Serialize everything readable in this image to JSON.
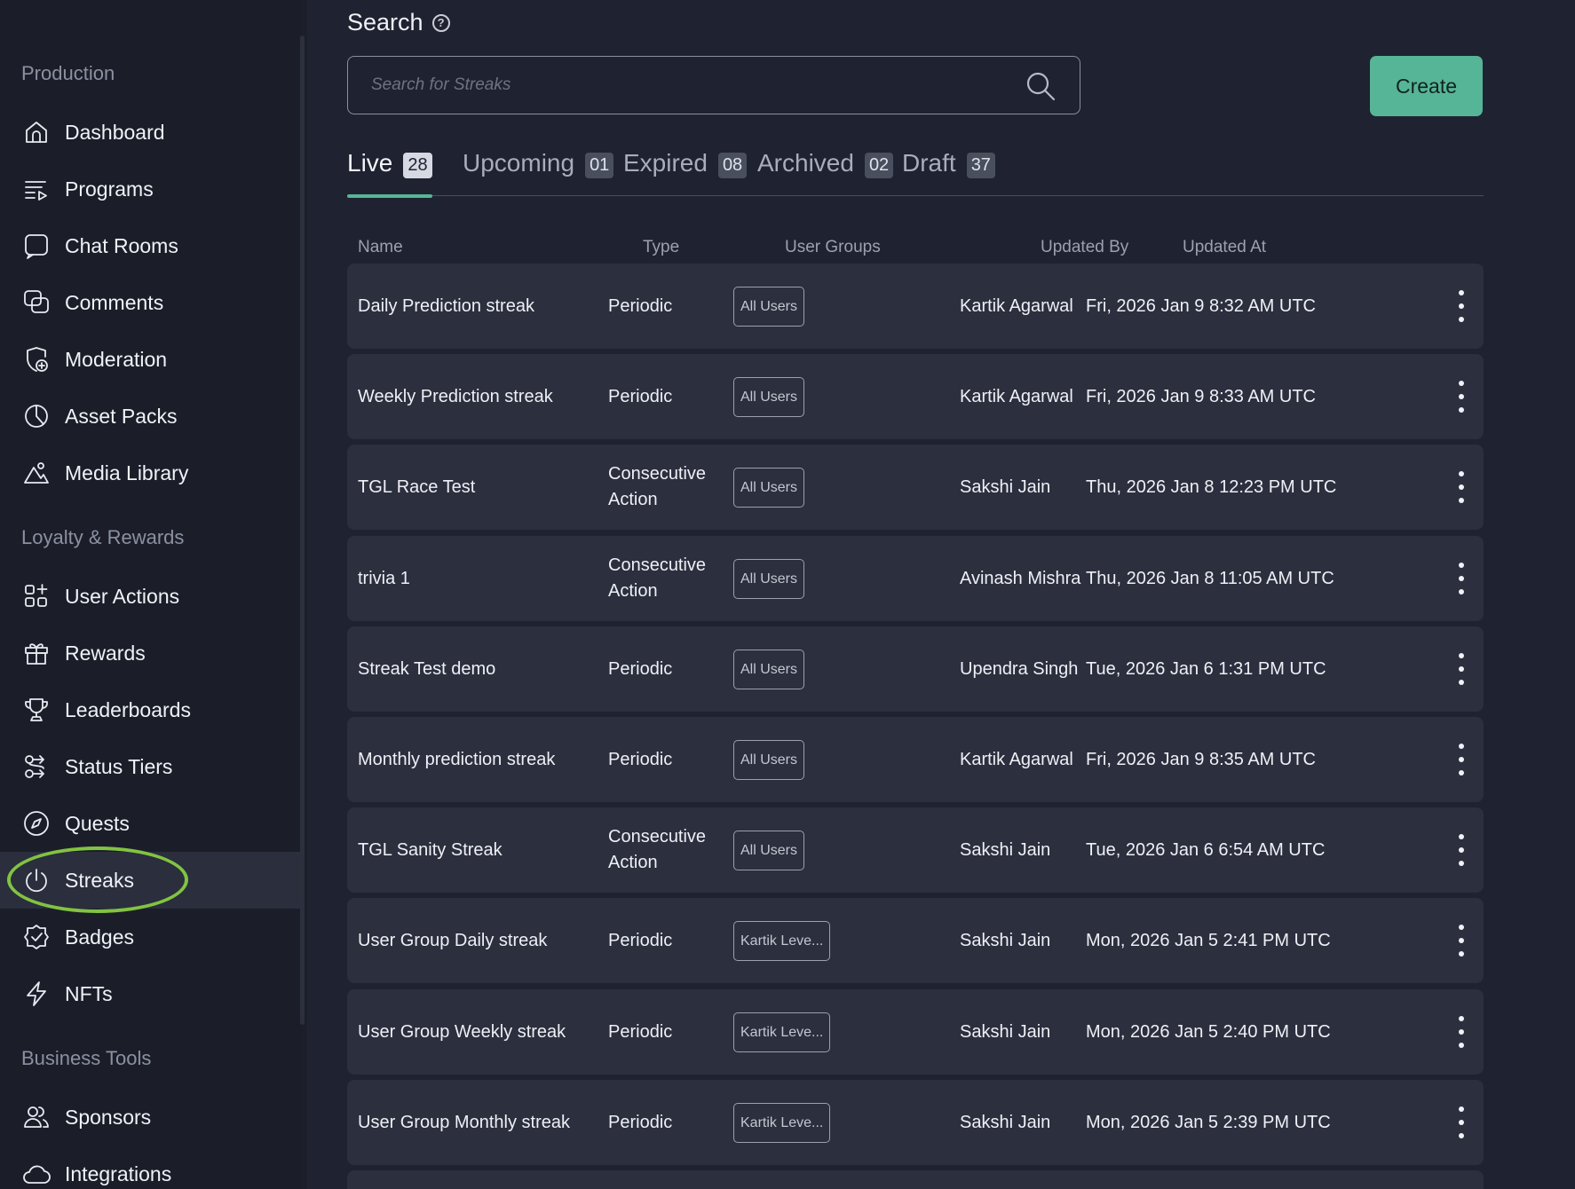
{
  "sidebar": {
    "sections": [
      {
        "title": "Production"
      },
      {
        "title": "Loyalty & Rewards"
      },
      {
        "title": "Business Tools"
      }
    ],
    "items": [
      {
        "label": "Dashboard",
        "icon": "home-icon"
      },
      {
        "label": "Programs",
        "icon": "programs-icon"
      },
      {
        "label": "Chat Rooms",
        "icon": "chat-icon"
      },
      {
        "label": "Comments",
        "icon": "comments-icon"
      },
      {
        "label": "Moderation",
        "icon": "moderation-icon"
      },
      {
        "label": "Asset Packs",
        "icon": "asset-packs-icon"
      },
      {
        "label": "Media Library",
        "icon": "media-library-icon"
      },
      {
        "label": "User Actions",
        "icon": "user-actions-icon"
      },
      {
        "label": "Rewards",
        "icon": "gift-icon"
      },
      {
        "label": "Leaderboards",
        "icon": "trophy-icon"
      },
      {
        "label": "Status Tiers",
        "icon": "status-tiers-icon"
      },
      {
        "label": "Quests",
        "icon": "compass-icon"
      },
      {
        "label": "Streaks",
        "icon": "streak-icon"
      },
      {
        "label": "Badges",
        "icon": "badge-icon"
      },
      {
        "label": "NFTs",
        "icon": "lightning-icon"
      },
      {
        "label": "Sponsors",
        "icon": "users-icon"
      },
      {
        "label": "Integrations",
        "icon": "cloud-icon"
      }
    ],
    "active_item": "Streaks"
  },
  "main": {
    "search_title": "Search",
    "search_placeholder": "Search for Streaks",
    "create_label": "Create",
    "tabs": [
      {
        "label": "Live",
        "count": "28"
      },
      {
        "label": "Upcoming",
        "count": "01"
      },
      {
        "label": "Expired",
        "count": "08"
      },
      {
        "label": "Archived",
        "count": "02"
      },
      {
        "label": "Draft",
        "count": "37"
      }
    ],
    "active_tab": "Live",
    "columns": [
      "Name",
      "Type",
      "User Groups",
      "Updated By",
      "Updated At"
    ],
    "rows": [
      {
        "name": "Daily Prediction streak",
        "type": "Periodic",
        "group": "All Users",
        "by": "Kartik Agarwal",
        "at": "Fri, 2026 Jan 9 8:32 AM UTC"
      },
      {
        "name": "Weekly Prediction streak",
        "type": "Periodic",
        "group": "All Users",
        "by": "Kartik Agarwal",
        "at": "Fri, 2026 Jan 9 8:33 AM UTC"
      },
      {
        "name": "TGL Race Test",
        "type": "Consecutive Action",
        "group": "All Users",
        "by": "Sakshi Jain",
        "at": "Thu, 2026 Jan 8 12:23 PM UTC"
      },
      {
        "name": "trivia 1",
        "type": "Consecutive Action",
        "group": "All Users",
        "by": "Avinash Mishra",
        "at": "Thu, 2026 Jan 8 11:05 AM UTC"
      },
      {
        "name": "Streak Test demo",
        "type": "Periodic",
        "group": "All Users",
        "by": "Upendra Singh",
        "at": "Tue, 2026 Jan 6 1:31 PM UTC"
      },
      {
        "name": "Monthly prediction streak",
        "type": "Periodic",
        "group": "All Users",
        "by": "Kartik Agarwal",
        "at": "Fri, 2026 Jan 9 8:35 AM UTC"
      },
      {
        "name": "TGL Sanity Streak",
        "type": "Consecutive Action",
        "group": "All Users",
        "by": "Sakshi Jain",
        "at": "Tue, 2026 Jan 6 6:54 AM UTC"
      },
      {
        "name": "User Group Daily streak",
        "type": "Periodic",
        "group": "Kartik Leve...",
        "by": "Sakshi Jain",
        "at": "Mon, 2026 Jan 5 2:41 PM UTC"
      },
      {
        "name": "User Group Weekly streak",
        "type": "Periodic",
        "group": "Kartik Leve...",
        "by": "Sakshi Jain",
        "at": "Mon, 2026 Jan 5 2:40 PM UTC"
      },
      {
        "name": "User Group Monthly streak",
        "type": "Periodic",
        "group": "Kartik Leve...",
        "by": "Sakshi Jain",
        "at": "Mon, 2026 Jan 5 2:39 PM UTC"
      }
    ]
  },
  "colors": {
    "accent": "#56b596",
    "highlight_ring": "#82c341",
    "background": "#1f2230",
    "row": "#2b2f3e"
  }
}
